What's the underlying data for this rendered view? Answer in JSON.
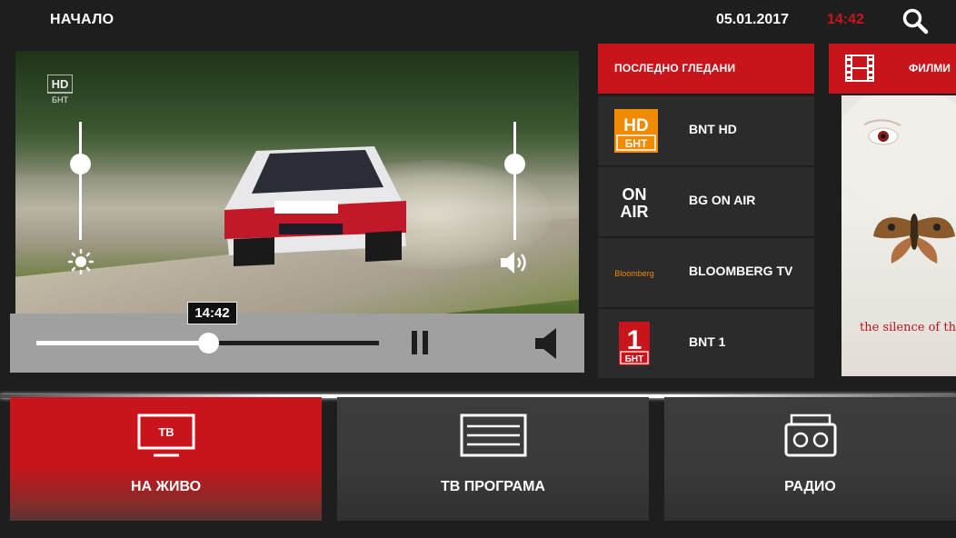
{
  "header": {
    "home_label": "НАЧАЛО",
    "date": "05.01.2017",
    "time": "14:42",
    "search_icon": "search-icon"
  },
  "player": {
    "overlay_logo_text": "HD",
    "overlay_logo_sub": "БНТ",
    "brightness_level": 0.65,
    "volume_level": 0.65,
    "seek_time": "14:42",
    "seek_progress": 0.5
  },
  "recent": {
    "header": "ПОСЛЕДНО ГЛЕДАНИ",
    "items": [
      {
        "name": "BNT HD",
        "logo_text": "HD",
        "logo_sub": "БНТ"
      },
      {
        "name": "BG ON AIR",
        "logo_text": "ON AIR"
      },
      {
        "name": "BLOOMBERG TV",
        "logo_text": "Bloomberg"
      },
      {
        "name": "BNT 1",
        "logo_text": "1",
        "logo_sub": "БНТ"
      }
    ]
  },
  "films": {
    "header": "ФИЛМИ",
    "poster_title": "the silence of the"
  },
  "tiles": [
    {
      "label": "НА ЖИВО",
      "icon_text": "ТВ",
      "icon": "tv-icon"
    },
    {
      "label": "ТВ ПРОГРАМА",
      "icon": "guide-icon"
    },
    {
      "label": "РАДИО",
      "icon": "radio-icon"
    }
  ],
  "colors": {
    "accent": "#c8141a",
    "background": "#1e1e1e",
    "tile": "#3a3a3a",
    "controls": "#a0a0a0"
  }
}
